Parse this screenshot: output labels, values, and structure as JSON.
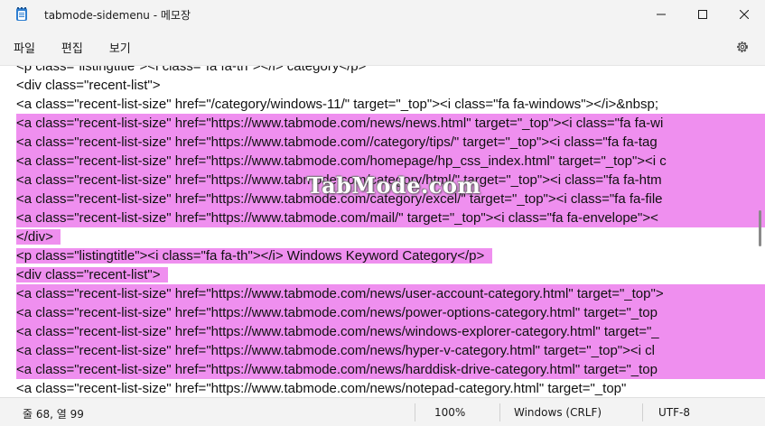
{
  "window": {
    "title": "tabmode-sidemenu - 메모장",
    "icon": "notepad-icon",
    "controls": [
      "minimize-icon",
      "maximize-icon",
      "close-icon"
    ]
  },
  "menu": {
    "items": [
      {
        "label": "파일"
      },
      {
        "label": "편집"
      },
      {
        "label": "보기"
      }
    ],
    "settings_icon": "gear-icon"
  },
  "editor": {
    "lines": [
      {
        "text": "<p class=\"listingtitle\"><i class=\"fa fa-th\"></i> category</p>",
        "highlighted": false,
        "full": false
      },
      {
        "text": "<div class=\"recent-list\">",
        "highlighted": false,
        "full": false
      },
      {
        "text": "<a class=\"recent-list-size\" href=\"/category/windows-11/\" target=\"_top\"><i class=\"fa fa-windows\"></i>&nbsp;",
        "highlighted": false,
        "full": false
      },
      {
        "text": "<a class=\"recent-list-size\" href=\"https://www.tabmode.com/news/news.html\" target=\"_top\"><i class=\"fa fa-wi",
        "highlighted": true,
        "full": true
      },
      {
        "text": "<a class=\"recent-list-size\" href=\"https://www.tabmode.com//category/tips/\" target=\"_top\"><i class=\"fa fa-tag",
        "highlighted": true,
        "full": true
      },
      {
        "text": "<a class=\"recent-list-size\" href=\"https://www.tabmode.com/homepage/hp_css_index.html\" target=\"_top\"><i c",
        "highlighted": true,
        "full": true
      },
      {
        "text": "<a class=\"recent-list-size\" href=\"https://www.tabmode.com/category/html/\" target=\"_top\"><i class=\"fa fa-htm",
        "highlighted": true,
        "full": true
      },
      {
        "text": "<a class=\"recent-list-size\" href=\"https://www.tabmode.com/category/excel/\" target=\"_top\"><i class=\"fa fa-file",
        "highlighted": true,
        "full": true
      },
      {
        "text": "<a class=\"recent-list-size\" href=\"https://www.tabmode.com/mail/\" target=\"_top\"><i class=\"fa fa-envelope\"><",
        "highlighted": true,
        "full": true
      },
      {
        "text": "</div>  ",
        "highlighted": true,
        "full": false
      },
      {
        "text": "<p class=\"listingtitle\"><i class=\"fa fa-th\"></i> Windows Keyword Category</p>  ",
        "highlighted": true,
        "full": false
      },
      {
        "text": "<div class=\"recent-list\">  ",
        "highlighted": true,
        "full": false
      },
      {
        "text": "<a class=\"recent-list-size\" href=\"https://www.tabmode.com/news/user-account-category.html\" target=\"_top\">",
        "highlighted": true,
        "full": true
      },
      {
        "text": "<a class=\"recent-list-size\" href=\"https://www.tabmode.com/news/power-options-category.html\" target=\"_top",
        "highlighted": true,
        "full": true
      },
      {
        "text": "<a class=\"recent-list-size\" href=\"https://www.tabmode.com/news/windows-explorer-category.html\" target=\"_",
        "highlighted": true,
        "full": true
      },
      {
        "text": "<a class=\"recent-list-size\" href=\"https://www.tabmode.com/news/hyper-v-category.html\" target=\"_top\"><i cl",
        "highlighted": true,
        "full": true
      },
      {
        "text": "<a class=\"recent-list-size\" href=\"https://www.tabmode.com/news/harddisk-drive-category.html\" target=\"_top",
        "highlighted": true,
        "full": true
      },
      {
        "text": "<a class=\"recent-list-size\" href=\"https://www.tabmode.com/news/notepad-category.html\" target=\"_top\"",
        "highlighted": false,
        "full": false
      }
    ],
    "watermark": "TabMode.com"
  },
  "status": {
    "position": "줄 68, 열 99",
    "zoom": "100%",
    "line_ending": "Windows (CRLF)",
    "encoding": "UTF-8"
  }
}
